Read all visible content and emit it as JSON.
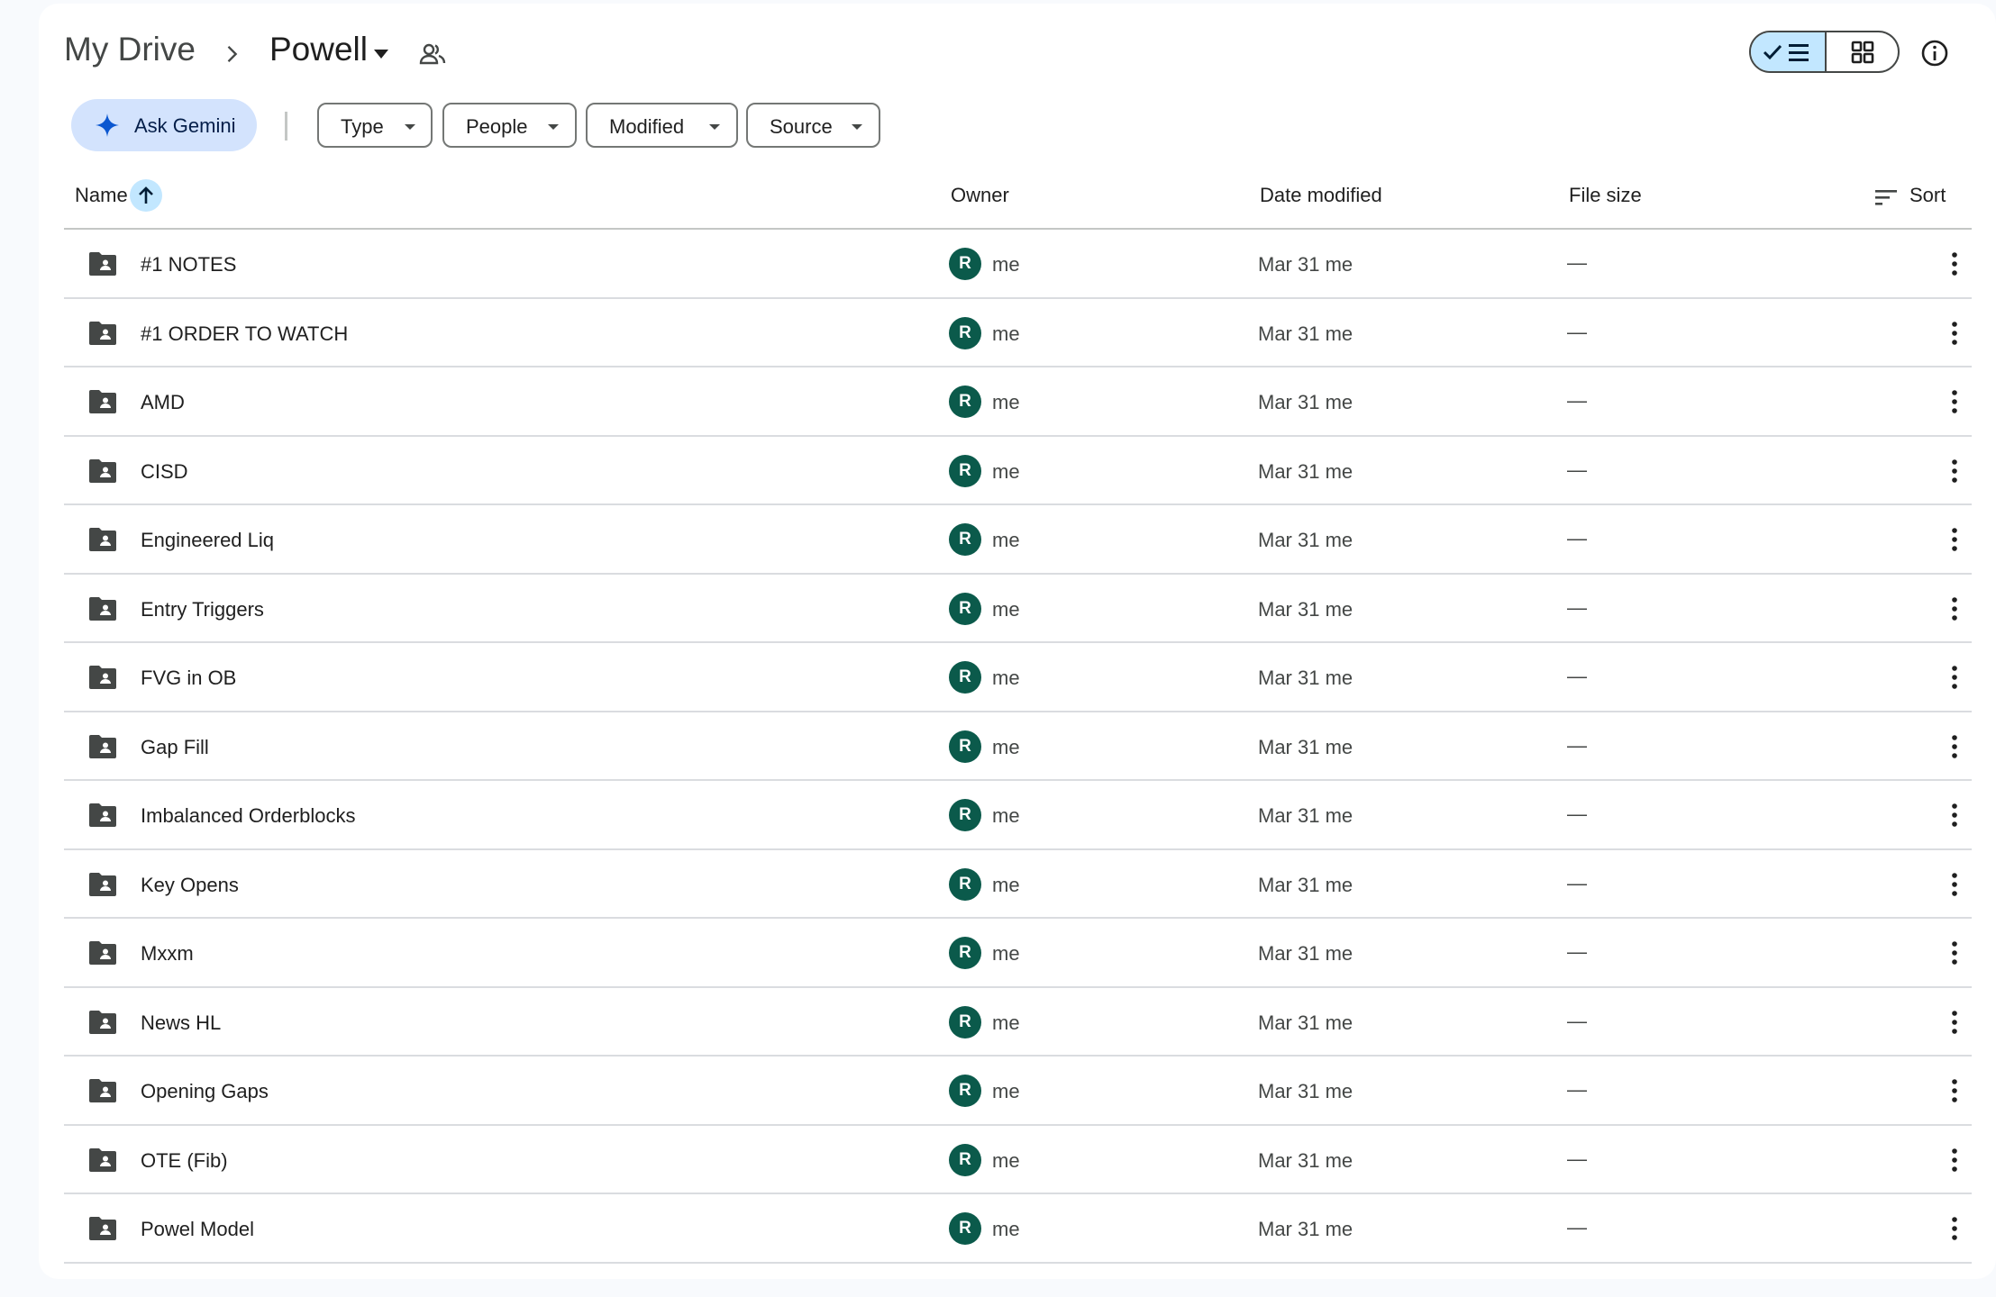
{
  "breadcrumb": {
    "root": "My Drive",
    "current": "Powell"
  },
  "filters": {
    "gemini_label": "Ask Gemini",
    "chips": [
      "Type",
      "People",
      "Modified",
      "Source"
    ]
  },
  "columns": {
    "name": "Name",
    "owner": "Owner",
    "date_modified": "Date modified",
    "file_size": "File size",
    "sort": "Sort"
  },
  "accent_color": "#c2e7ff",
  "avatar_color": "#0b5a4b",
  "rows": [
    {
      "name": "#1 NOTES",
      "avatar": "R",
      "owner": "me",
      "modified": "Mar 31 me",
      "size": "—"
    },
    {
      "name": "#1 ORDER TO WATCH",
      "avatar": "R",
      "owner": "me",
      "modified": "Mar 31 me",
      "size": "—"
    },
    {
      "name": "AMD",
      "avatar": "R",
      "owner": "me",
      "modified": "Mar 31 me",
      "size": "—"
    },
    {
      "name": "CISD",
      "avatar": "R",
      "owner": "me",
      "modified": "Mar 31 me",
      "size": "—"
    },
    {
      "name": "Engineered Liq",
      "avatar": "R",
      "owner": "me",
      "modified": "Mar 31 me",
      "size": "—"
    },
    {
      "name": "Entry Triggers",
      "avatar": "R",
      "owner": "me",
      "modified": "Mar 31 me",
      "size": "—"
    },
    {
      "name": "FVG in OB",
      "avatar": "R",
      "owner": "me",
      "modified": "Mar 31 me",
      "size": "—"
    },
    {
      "name": "Gap Fill",
      "avatar": "R",
      "owner": "me",
      "modified": "Mar 31 me",
      "size": "—"
    },
    {
      "name": "Imbalanced Orderblocks",
      "avatar": "R",
      "owner": "me",
      "modified": "Mar 31 me",
      "size": "—"
    },
    {
      "name": "Key Opens",
      "avatar": "R",
      "owner": "me",
      "modified": "Mar 31 me",
      "size": "—"
    },
    {
      "name": "Mxxm",
      "avatar": "R",
      "owner": "me",
      "modified": "Mar 31 me",
      "size": "—"
    },
    {
      "name": "News HL",
      "avatar": "R",
      "owner": "me",
      "modified": "Mar 31 me",
      "size": "—"
    },
    {
      "name": "Opening Gaps",
      "avatar": "R",
      "owner": "me",
      "modified": "Mar 31 me",
      "size": "—"
    },
    {
      "name": "OTE (Fib)",
      "avatar": "R",
      "owner": "me",
      "modified": "Mar 31 me",
      "size": "—"
    },
    {
      "name": "Powel Model",
      "avatar": "R",
      "owner": "me",
      "modified": "Mar 31 me",
      "size": "—"
    }
  ]
}
